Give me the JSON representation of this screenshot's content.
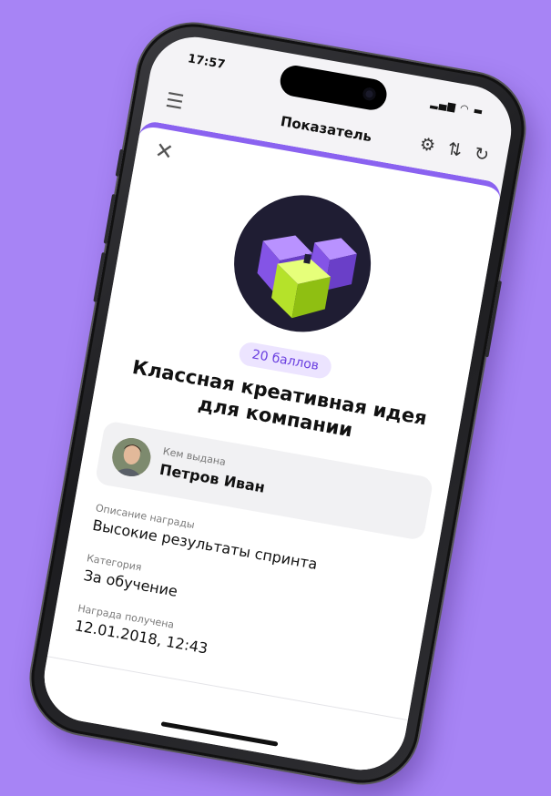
{
  "status_bar": {
    "time": "17:57",
    "indicators": "▂▄▆ ◠ ▬"
  },
  "navbar": {
    "menu_icon": "☰",
    "title": "Показатель",
    "icons": {
      "settings": "⚙",
      "sort": "⇅",
      "refresh": "↻"
    }
  },
  "sheet": {
    "close_icon": "✕",
    "points": "20 баллов",
    "title": "Классная креативная идея для компании",
    "giver": {
      "label": "Кем выдана",
      "name": "Петров Иван"
    },
    "fields": [
      {
        "label": "Описание награды",
        "value": "Высокие результаты спринта"
      },
      {
        "label": "Категория",
        "value": "За обучение"
      },
      {
        "label": "Награда получена",
        "value": "12.01.2018, 12:43"
      }
    ]
  },
  "colors": {
    "background": "#a784f5",
    "accent": "#8a62f0",
    "points_text": "#6a3fe0",
    "points_bg": "#ece4ff",
    "cube_green": "#c8f43a",
    "cube_purple": "#9b67f0"
  }
}
